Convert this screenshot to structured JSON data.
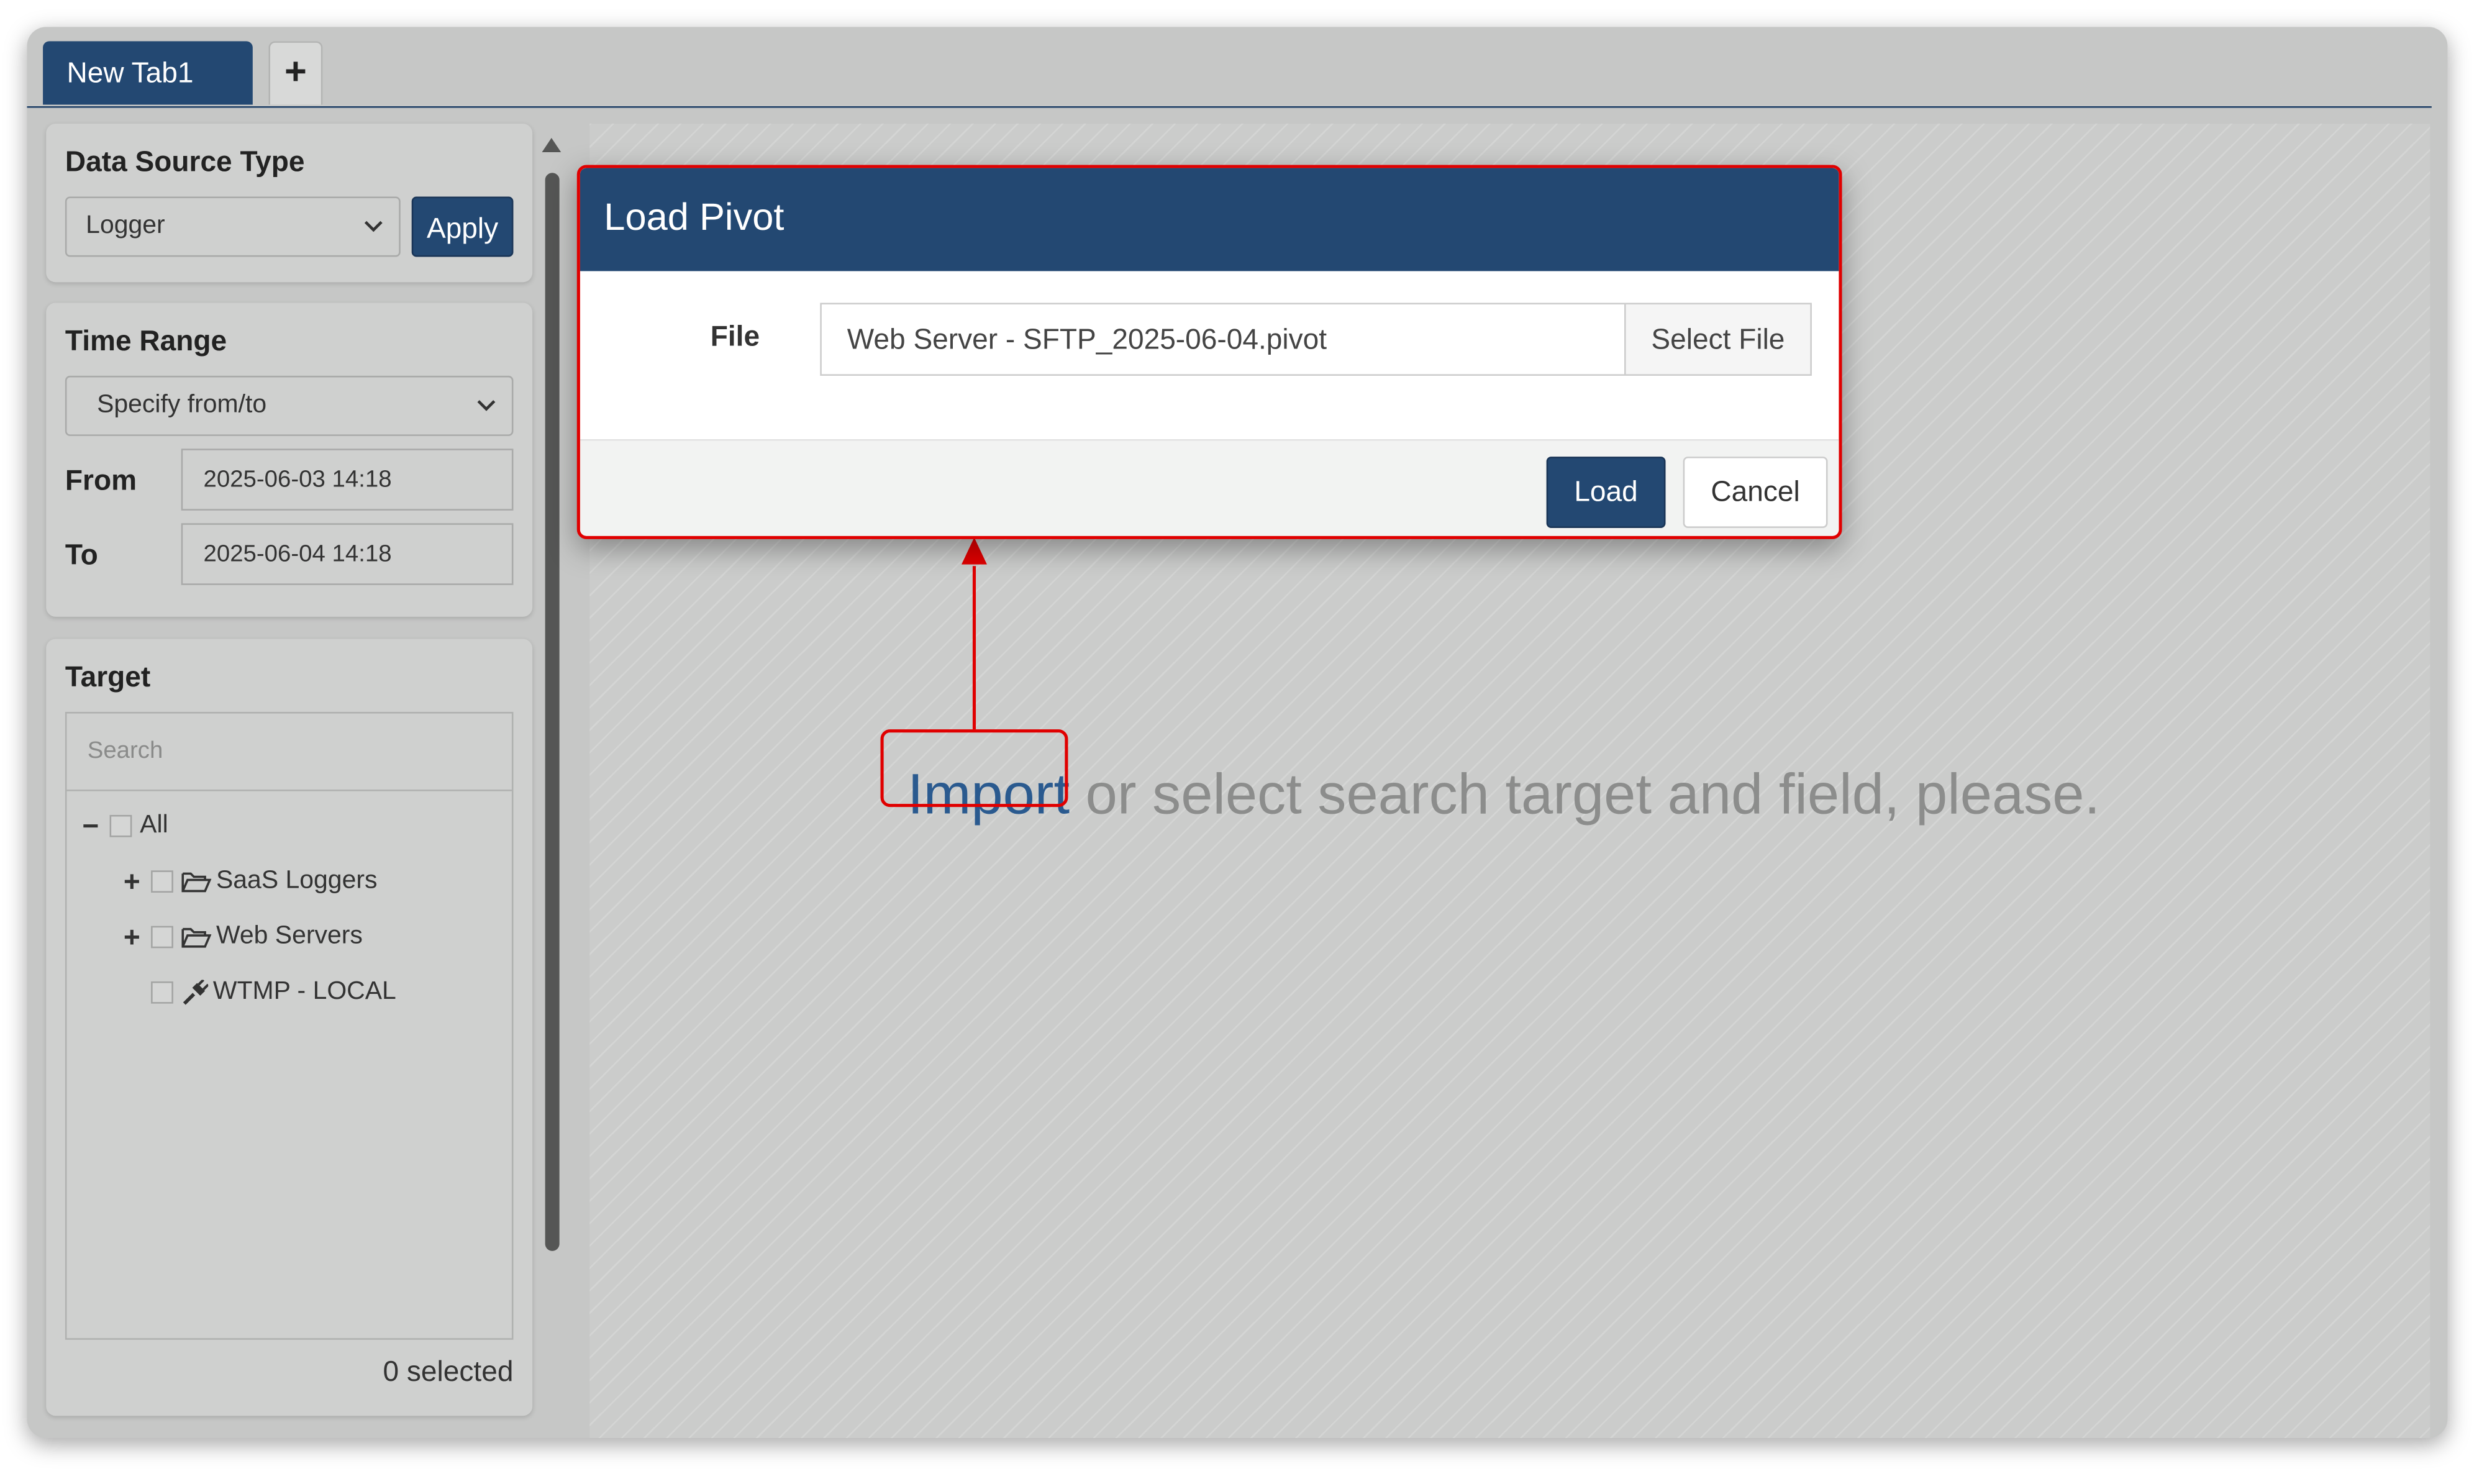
{
  "tabs": {
    "active_label": "New Tab1",
    "add_label": "+"
  },
  "sidebar": {
    "data_source": {
      "title": "Data Source Type",
      "selected": "Logger",
      "apply_label": "Apply"
    },
    "time_range": {
      "title": "Time Range",
      "selected": "Specify from/to",
      "from_label": "From",
      "from_value": "2025-06-03 14:18",
      "to_label": "To",
      "to_value": "2025-06-04 14:18"
    },
    "target": {
      "title": "Target",
      "search_placeholder": "Search",
      "tree": [
        {
          "label": "All",
          "expander": "−",
          "icon": "none"
        },
        {
          "label": "SaaS Loggers",
          "expander": "+",
          "icon": "folder-open-icon"
        },
        {
          "label": "Web Servers",
          "expander": "+",
          "icon": "folder-open-icon"
        },
        {
          "label": "WTMP - LOCAL",
          "expander": "",
          "icon": "plug-icon"
        }
      ],
      "selected_count": "0 selected"
    }
  },
  "main": {
    "import_link": "Import",
    "placeholder_rest": " or select search target and field, please."
  },
  "modal": {
    "title": "Load Pivot",
    "file_label": "File",
    "file_value": "Web Server - SFTP_2025-06-04.pivot",
    "select_file_label": "Select File",
    "load_label": "Load",
    "cancel_label": "Cancel"
  },
  "colors": {
    "accent": "#234872",
    "highlight": "#e00000",
    "background": "#c6c7c6"
  }
}
